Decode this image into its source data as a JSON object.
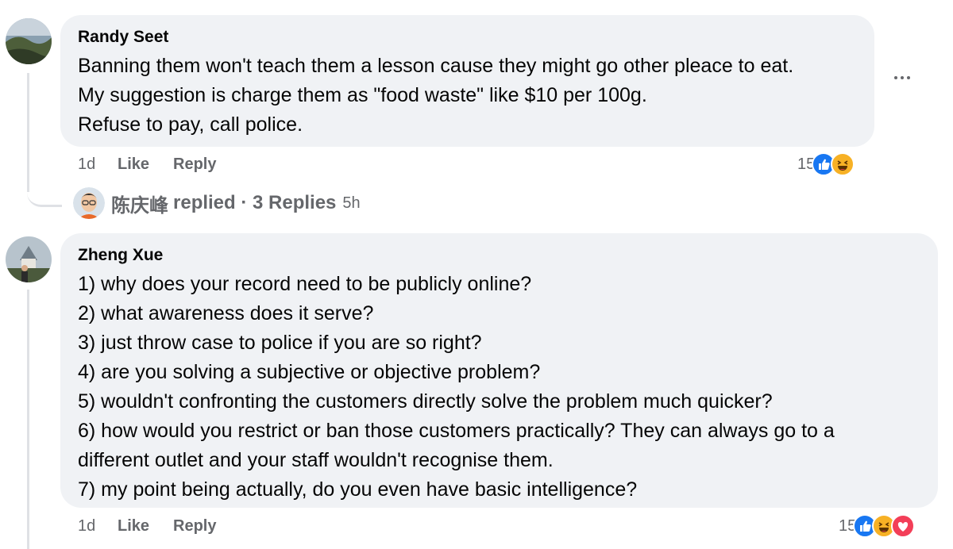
{
  "comments": [
    {
      "author": "Randy Seet",
      "lines": [
        "Banning them won't teach them a lesson cause they might go other pleace to eat.",
        "My suggestion is charge them as \"food waste\" like $10 per 100g.",
        "Refuse to pay, call police."
      ],
      "time": "1d",
      "like_label": "Like",
      "reply_label": "Reply",
      "reaction_count": "15",
      "reactions": [
        "like-icon",
        "haha-icon"
      ]
    },
    {
      "author": "Zheng Xue",
      "lines": [
        "1) why does your record need to be publicly online?",
        "2) what awareness does it serve?",
        "3) just throw case to police if you are so right?",
        "4) are you solving a subjective or objective problem?",
        "5) wouldn't confronting the customers directly solve the problem much quicker?",
        "6) how would you restrict or ban those customers practically? They can always go to a",
        "different outlet and your staff wouldn't recognise them.",
        "7) my point being actually, do you even have basic intelligence?"
      ],
      "time": "1d",
      "like_label": "Like",
      "reply_label": "Reply",
      "reaction_count": "15",
      "reactions": [
        "like-icon",
        "haha-icon",
        "love-icon"
      ]
    }
  ],
  "reply_summary": {
    "name": "陈庆峰",
    "text": "replied · 3 Replies",
    "time": "5h"
  },
  "colors": {
    "bubble": "#f0f2f5",
    "muted": "#65676b",
    "like_blue": "#1877f2",
    "haha_yellow": "#f7b125",
    "love_red": "#f33e58"
  }
}
